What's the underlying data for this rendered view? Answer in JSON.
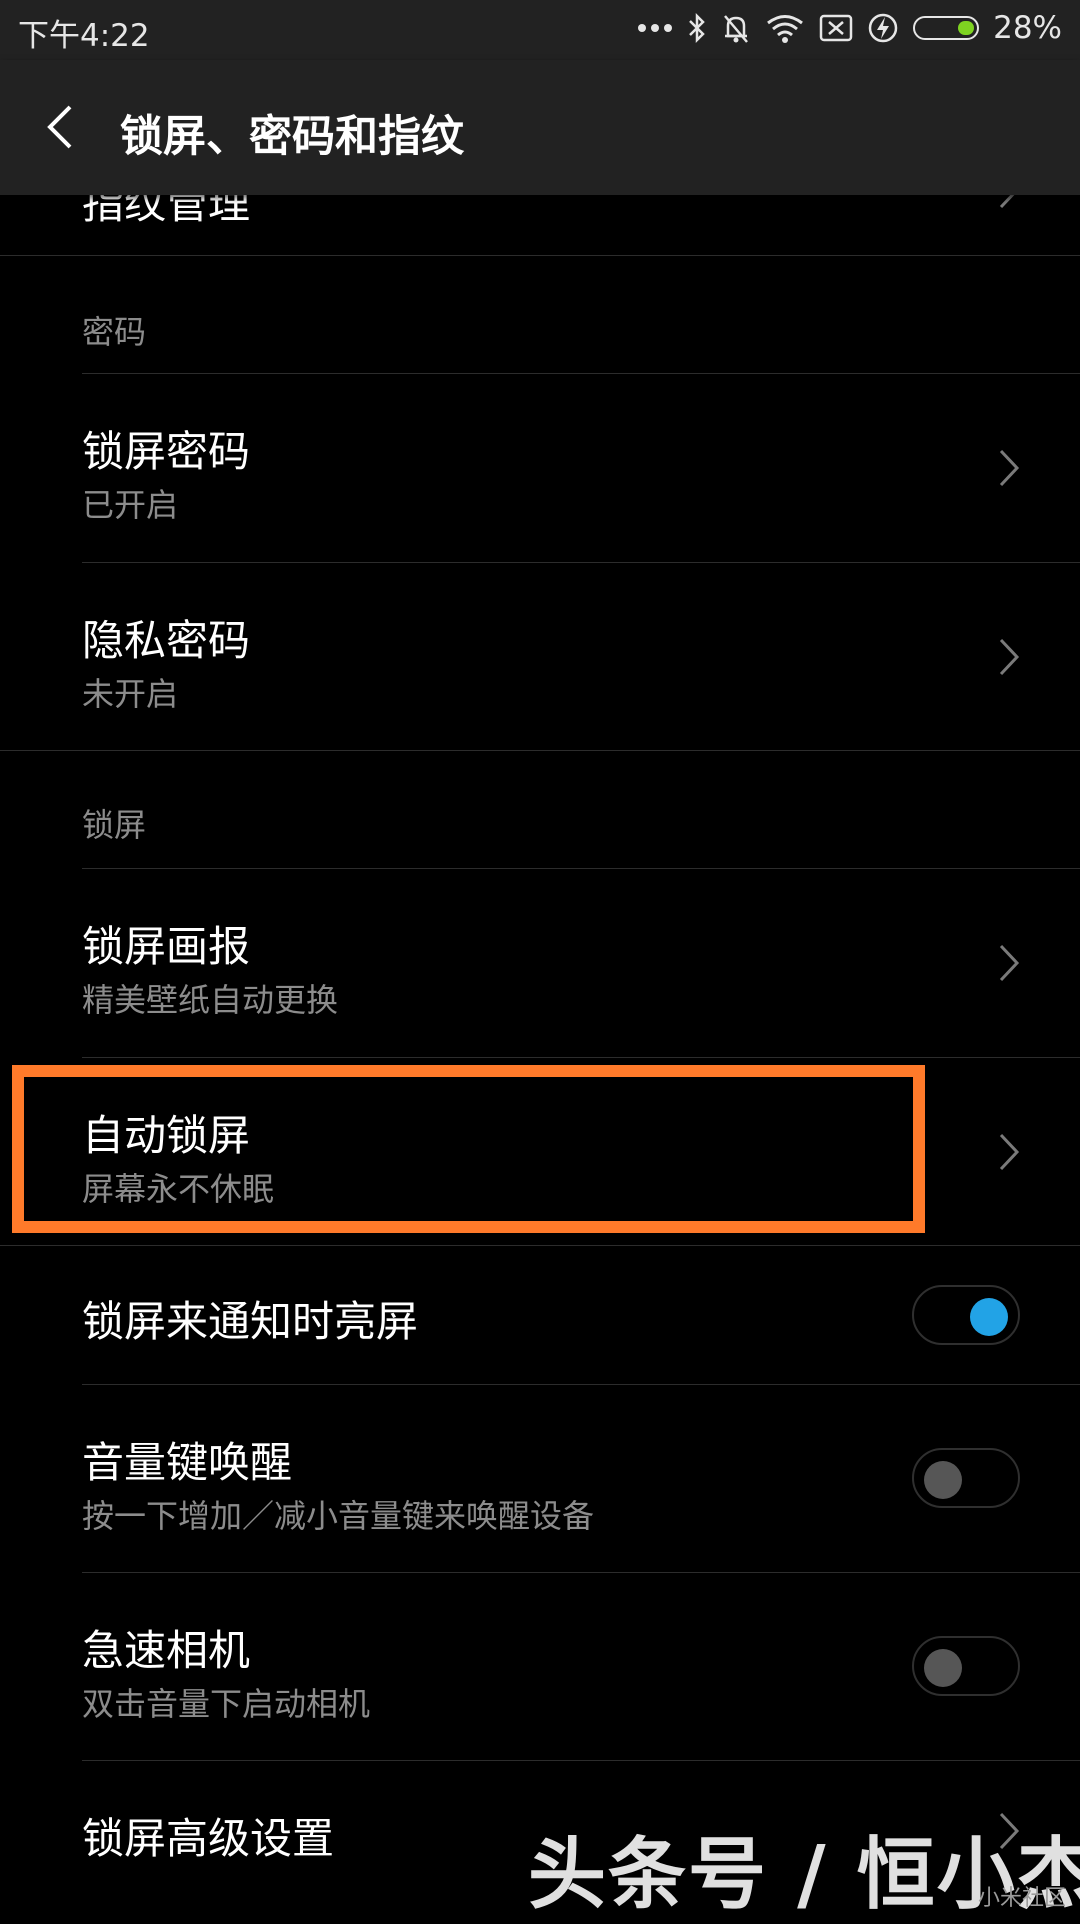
{
  "status_bar": {
    "time": "下午4:22",
    "battery_percent": "28%",
    "icons": [
      "more-dots-icon",
      "bluetooth-icon",
      "silent-bell-icon",
      "wifi-icon",
      "no-sim-icon",
      "charging-icon",
      "battery-icon"
    ]
  },
  "app_bar": {
    "title": "锁屏、密码和指纹"
  },
  "partial_top_item": {
    "label": "指纹管理"
  },
  "sections": {
    "password": {
      "header": "密码",
      "items": [
        {
          "title": "锁屏密码",
          "subtitle": "已开启"
        },
        {
          "title": "隐私密码",
          "subtitle": "未开启"
        }
      ]
    },
    "lockscreen": {
      "header": "锁屏",
      "items": [
        {
          "title": "锁屏画报",
          "subtitle": "精美壁纸自动更换"
        },
        {
          "title": "自动锁屏",
          "subtitle": "屏幕永不休眠"
        },
        {
          "title": "锁屏来通知时亮屏",
          "toggle": true
        },
        {
          "title": "音量键唤醒",
          "subtitle": "按一下增加／减小音量键来唤醒设备",
          "toggle": false
        },
        {
          "title": "急速相机",
          "subtitle": "双击音量下启动相机",
          "toggle": false
        },
        {
          "title": "锁屏高级设置"
        }
      ]
    }
  },
  "watermark": {
    "text": "头条号 / 恒小杰",
    "corner": "小米社区"
  },
  "colors": {
    "highlight": "#ff7a2a",
    "toggle_on": "#22a3e6",
    "toggle_off": "#565656",
    "bar_bg": "#222222",
    "battery_fill": "#7ed321"
  }
}
